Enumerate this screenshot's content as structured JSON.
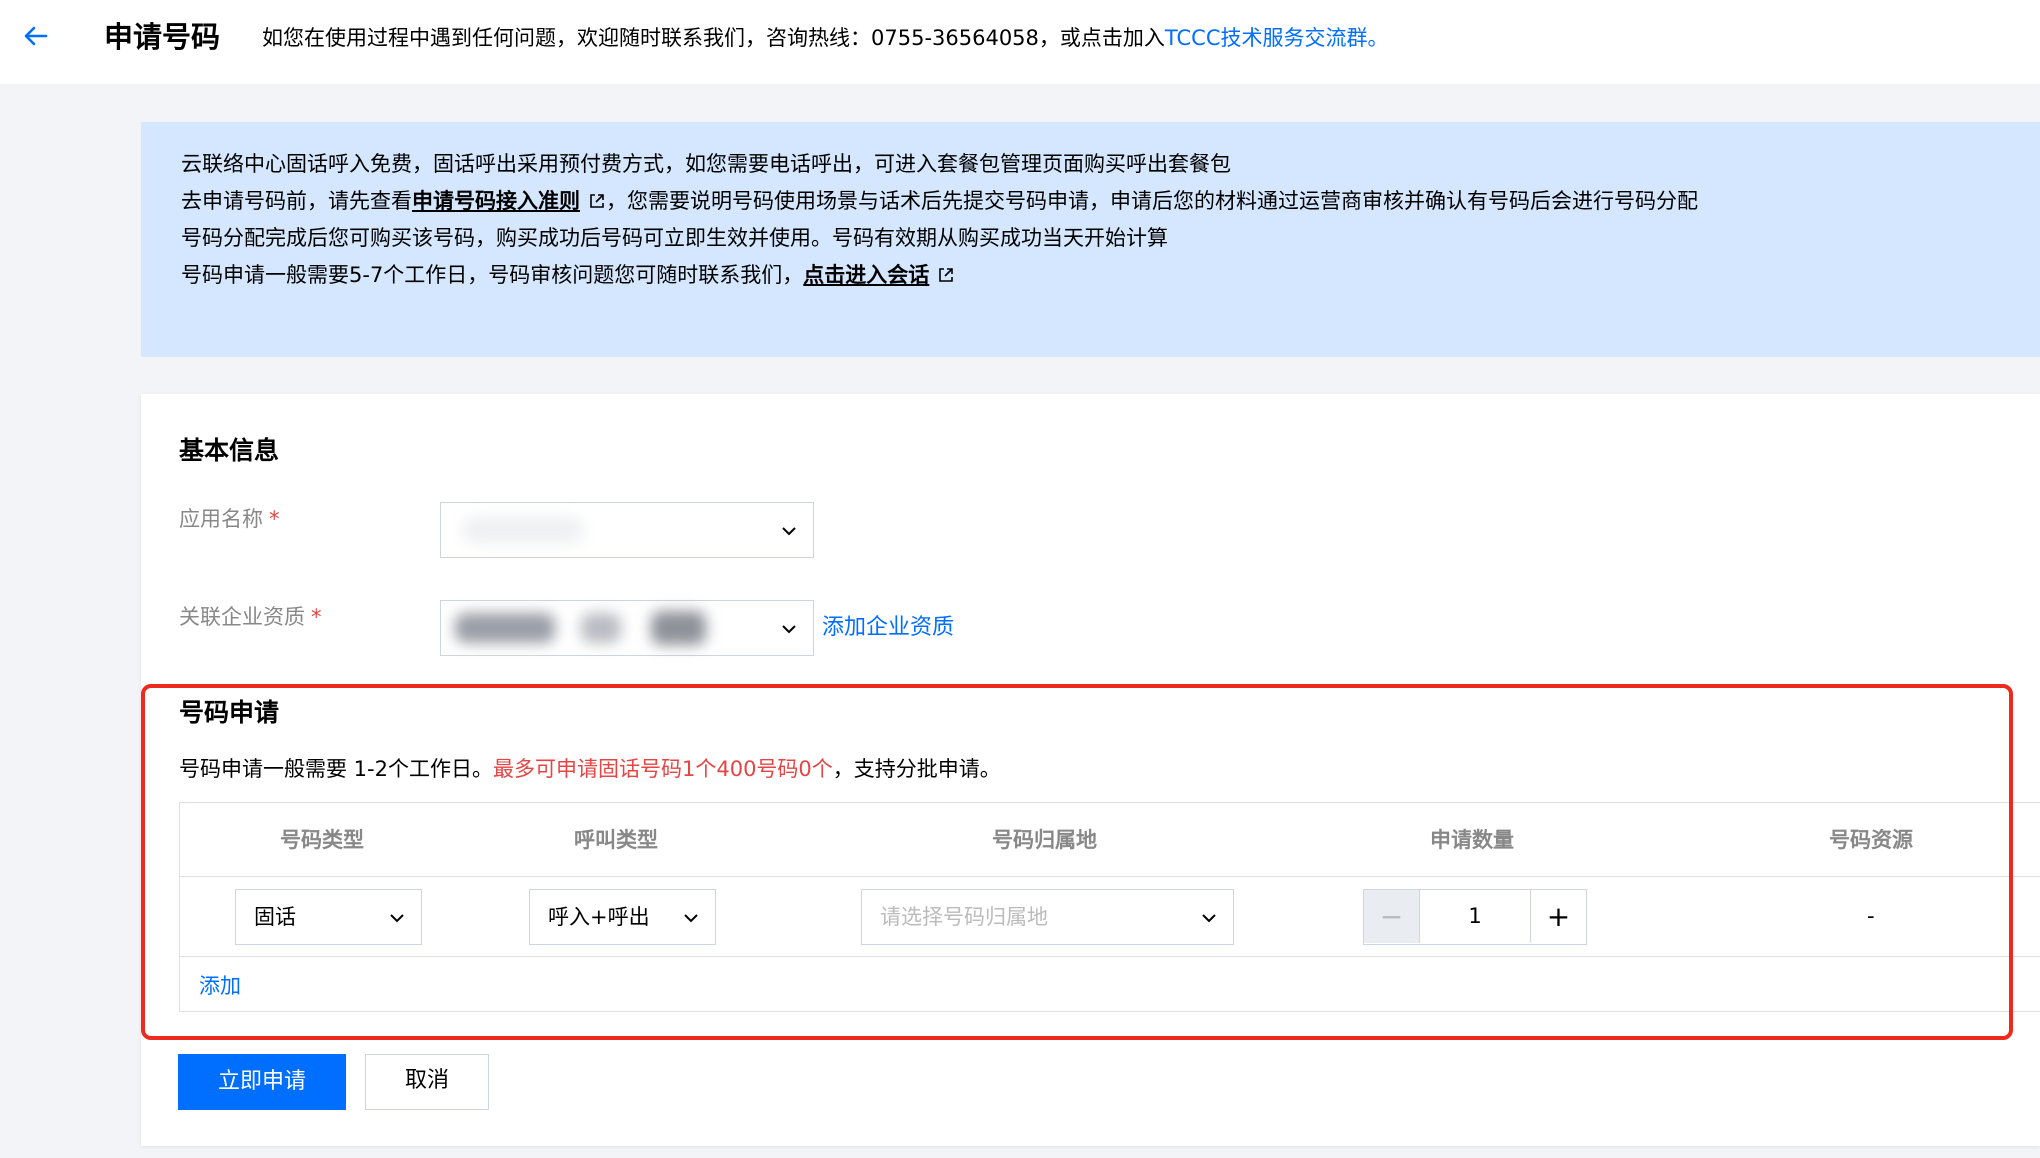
{
  "header": {
    "title": "申请号码",
    "desc_prefix": "如您在使用过程中遇到任何问题，欢迎随时联系我们，咨询热线：0755-36564058，或点击加入",
    "desc_link": "TCCC技术服务交流群。"
  },
  "notice": {
    "line1": "云联络中心固话呼入免费，固话呼出采用预付费方式，如您需要电话呼出，可进入套餐包管理页面购买呼出套餐包",
    "line2_prefix": "去申请号码前，请先查看",
    "line2_link": "申请号码接入准则",
    "line2_suffix": "，您需要说明号码使用场景与话术后先提交号码申请，申请后您的材料通过运营商审核并确认有号码后会进行号码分配",
    "line3": "号码分配完成后您可购买该号码，购买成功后号码可立即生效并使用。号码有效期从购买成功当天开始计算",
    "line4_prefix": "号码申请一般需要5-7个工作日，号码审核问题您可随时联系我们，",
    "line4_link": "点击进入会话"
  },
  "basic_info": {
    "title": "基本信息",
    "app_name_label": "应用名称",
    "company_label": "关联企业资质",
    "required_mark": "*",
    "add_company_link": "添加企业资质"
  },
  "number_apply": {
    "title": "号码申请",
    "desc_prefix": "号码申请一般需要 1-2个工作日。",
    "desc_warn": "最多可申请固话号码1个400号码0个",
    "desc_suffix": "，支持分批申请。",
    "columns": [
      "号码类型",
      "呼叫类型",
      "号码归属地",
      "申请数量",
      "号码资源"
    ],
    "row": {
      "number_type": "固话",
      "call_type": "呼入+呼出",
      "location_placeholder": "请选择号码归属地",
      "quantity": "1",
      "resource": "-"
    },
    "add_link": "添加"
  },
  "actions": {
    "submit": "立即申请",
    "cancel": "取消"
  },
  "colors": {
    "primary": "#006eff",
    "notice_bg": "#d5e7ff",
    "warn": "#e54545",
    "highlight": "#ee2a1f"
  }
}
